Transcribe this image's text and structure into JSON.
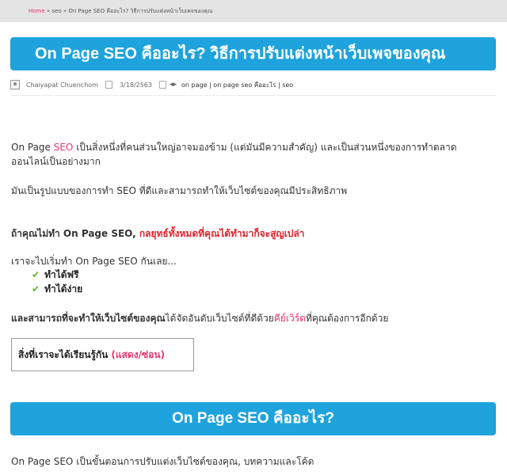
{
  "breadcrumb": {
    "home": "Home",
    "sep1": " » ",
    "cat": "seo",
    "sep2": " » ",
    "current": "On Page SEO คืออะไร? วิธีการปรับแต่งหน้าเว็บเพจของคุณ"
  },
  "article": {
    "title": "On Page SEO คืออะไร? วิธีการปรับแต่งหน้าเว็บเพจของคุณ",
    "author": "Chaiyapat Chuenchom",
    "date": "3/18/2563",
    "tags": "on page | on page seo คืออะไร | seo"
  },
  "content": {
    "p1_line1_a": "On Page ",
    "p1_line1_seo": "SEO",
    "p1_line1_b": " เป็นสิ่งหนึ่งที่คนส่วนใหญ่อาจมองข้าม (แต่มันมีความสำคัญ) และเป็นส่วนหนึ่งของการทำตลาด",
    "p1_line2": "ออนไลน์เป็นอย่างมาก",
    "p2": "มันเป็นรูปแบบของการทำ SEO ที่ดีและสามารถทำให้เว็บไซต์ของคุณมีประสิทธิภาพ",
    "p3_a": "ถ้าคุณไม่ทำ On Page SEO, ",
    "p3_b": "กลยุทธ์ทั้งหมดที่คุณได้ทำมาก็จะสูญเปล่า",
    "p4": "เราจะไปเริ่มทำ On Page SEO กันเลย...",
    "checklist": [
      "ทำได้ฟรี",
      "ทำได้ง่าย"
    ],
    "p5_a": "และสามารถที่จะทำให้เว็บไซต์ของคุณ",
    "p5_b": "ได้จัดอันดับเว็บไซต์ที่ดีด้วย",
    "p5_keyword": "คีย์เวิร์ด",
    "p5_c": "ที่คุณต้องการอีกด้วย",
    "p6": "On Page SEO เป็นขั้นตอนการปรับแต่งเว็บไซต์ของคุณ, บทความและโค้ด"
  },
  "toc": {
    "label": "สิ่งที่เราจะได้เรียนรู้กัน",
    "toggle": "(แสดง/ซ่อน)"
  },
  "section": {
    "heading": "On Page SEO คืออะไร?"
  },
  "colors": {
    "banner": "#1ea3dc",
    "accent_pink": "#e8356b",
    "accent_red": "#e0232c",
    "check_green": "#5cb82a"
  }
}
